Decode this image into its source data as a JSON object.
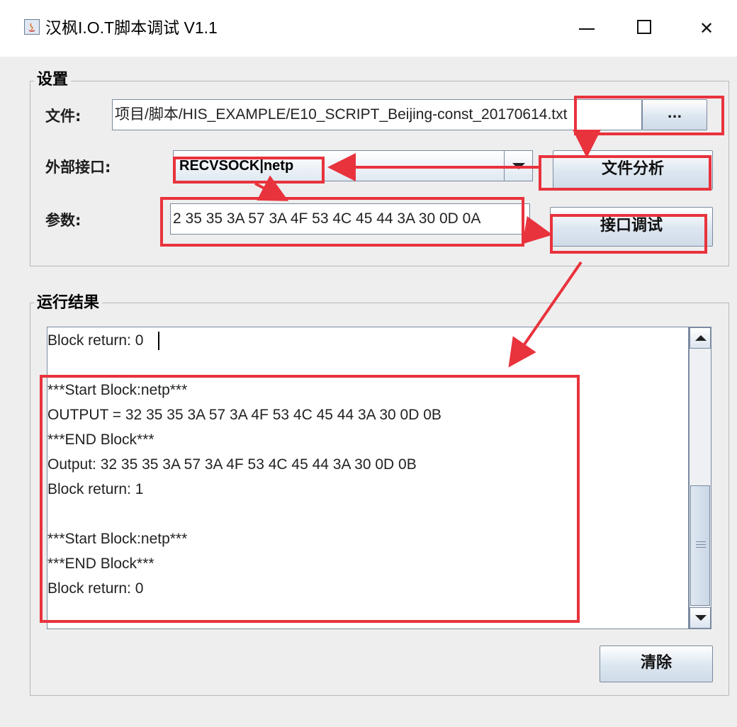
{
  "window": {
    "title": "汉枫I.O.T脚本调试 V1.1",
    "minimize_icon": "minimize-icon",
    "maximize_icon": "maximize-icon",
    "close_icon": "close-icon",
    "close_glyph": "✕"
  },
  "settings": {
    "group_title": "设置",
    "file_label": "文件:",
    "file_value": "项目/脚本/HIS_EXAMPLE/E10_SCRIPT_Beijing-const_20170614.txt",
    "browse_label": "...",
    "interface_label": "外部接口:",
    "interface_value": "RECVSOCK|netp",
    "analyze_label": "文件分析",
    "params_label": "参数:",
    "params_value": "2 35 35 3A 57 3A 4F 53 4C 45 44 3A 30 0D 0A",
    "debug_label": "接口调试"
  },
  "result": {
    "group_title": "运行结果",
    "lines": [
      "Block return: 0",
      "",
      "***Start Block:netp***",
      "OUTPUT = 32 35 35 3A 57 3A 4F 53 4C 45 44 3A 30 0D 0B",
      "***END Block***",
      "Output: 32 35 35 3A 57 3A 4F 53 4C 45 44 3A 30 0D 0B",
      "Block return: 1",
      "",
      "***Start Block:netp***",
      "***END Block***",
      "Block return: 0"
    ],
    "clear_label": "清除"
  },
  "colors": {
    "annotation": "#e8333d",
    "window_bg": "#eeeeee",
    "button_gradient_end": "#cfdbe8"
  }
}
